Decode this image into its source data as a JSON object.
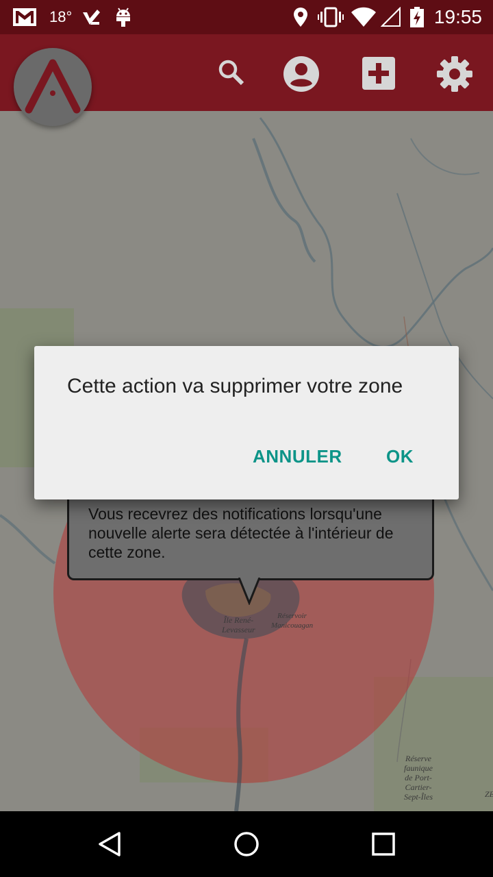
{
  "status_bar": {
    "temperature": "18°",
    "time": "19:55",
    "icons": [
      "gmail-icon",
      "temperature-text",
      "checkmark-app-icon",
      "android-icon",
      "location-icon",
      "vibrate-icon",
      "wifi-icon",
      "signal-icon",
      "battery-icon"
    ]
  },
  "app_bar": {
    "logo": "app-logo-A",
    "actions": [
      "search-icon",
      "account-icon",
      "add-box-icon",
      "settings-icon"
    ],
    "colors": {
      "bar": "#7a1720",
      "status": "#5e0d14",
      "logo_bg": "#6a6a6a",
      "logo_mark": "#7a1720"
    }
  },
  "map": {
    "zone_circle_color": "#b33a3a",
    "labels": {
      "ile_rene": "Île René-\nLevasseur",
      "reservoir": "Réservoir\nManicouagan",
      "reserve": "Réserve\nfaunique\nde Port-\nCartier-\nSept-Îles",
      "edge": "ZE"
    }
  },
  "bubble": {
    "text": "Vous recevrez des notifications lorsqu'une nouvelle alerte sera détectée à l'intérieur de cette zone."
  },
  "dialog": {
    "message": "Cette action va supprimer votre zone",
    "cancel_label": "ANNULER",
    "ok_label": "OK",
    "accent": "#0d9488"
  },
  "nav_bar": {
    "icons": [
      "back-icon",
      "home-icon",
      "recents-icon"
    ]
  }
}
